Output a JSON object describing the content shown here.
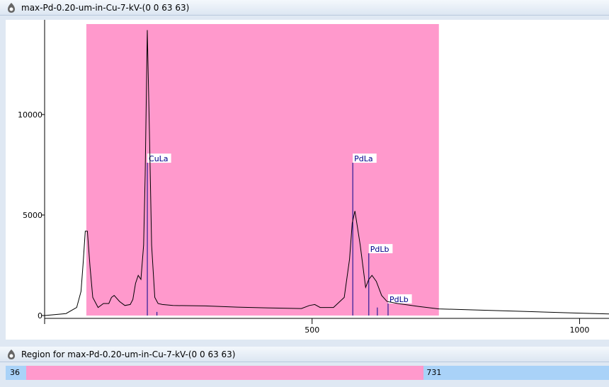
{
  "window": {
    "title": "max-Pd-0.20-um-in-Cu-7-kV-(0 0 63 63)"
  },
  "region_window": {
    "title": "Region for max-Pd-0.20-um-in-Cu-7-kV-(0 0 63 63)",
    "start": "36",
    "end": "731",
    "x_min": 0,
    "x_max": 1055
  },
  "colors": {
    "region": "#ff99cc",
    "label": "#00008b",
    "trace": "#000000",
    "bar": "#a9d2f8"
  },
  "chart_data": {
    "type": "line",
    "title": "",
    "xlabel": "",
    "ylabel": "",
    "xlim": [
      0,
      1055
    ],
    "ylim": [
      0,
      14500
    ],
    "x_ticks": [
      0,
      500,
      1000
    ],
    "x_tick_labels": [
      "",
      "500",
      "1000"
    ],
    "y_ticks": [
      0,
      5000,
      10000
    ],
    "y_tick_labels": [
      "0",
      "5000",
      "10000"
    ],
    "highlight_region": [
      78,
      737
    ],
    "series": [
      {
        "x": [
          0,
          40,
          60,
          68,
          72,
          76,
          80,
          85,
          90,
          100,
          110,
          120,
          125,
          130,
          140,
          150,
          160,
          165,
          170,
          175,
          180,
          185,
          188,
          192,
          196,
          200,
          206,
          212,
          220,
          240,
          300,
          360,
          420,
          480,
          495,
          505,
          515,
          540,
          560,
          570,
          575,
          580,
          590,
          600,
          606,
          612,
          620,
          630,
          640,
          660,
          700,
          737,
          800,
          900,
          1000,
          1055
        ],
        "values": [
          0,
          100,
          400,
          1200,
          2600,
          4200,
          4200,
          2400,
          900,
          400,
          600,
          600,
          900,
          1000,
          700,
          500,
          550,
          800,
          1600,
          2000,
          1800,
          3500,
          7000,
          14200,
          9000,
          3500,
          900,
          600,
          550,
          500,
          480,
          420,
          380,
          350,
          500,
          550,
          400,
          400,
          900,
          2800,
          4600,
          5200,
          3500,
          1400,
          1800,
          2000,
          1700,
          1000,
          700,
          600,
          450,
          330,
          280,
          200,
          120,
          80
        ]
      }
    ],
    "peak_markers": [
      {
        "label": "CuLa",
        "x": 192,
        "height": 7600
      },
      {
        "label": "",
        "x": 210,
        "height": 180
      },
      {
        "label": "PdLa",
        "x": 576,
        "height": 7600
      },
      {
        "label": "PdLb",
        "x": 606,
        "height": 3100
      },
      {
        "label": "",
        "x": 622,
        "height": 400
      },
      {
        "label": "PdLb",
        "x": 642,
        "height": 600
      }
    ]
  }
}
